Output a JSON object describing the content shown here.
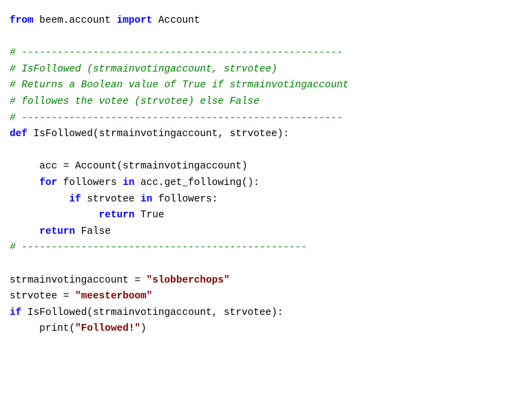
{
  "colors": {
    "background": "#ffffff",
    "keyword": "#0000ff",
    "comment": "#008000",
    "string": "#800000",
    "text": "#000000"
  },
  "code": {
    "language": "Python",
    "lines": [
      [
        [
          "kw",
          "from"
        ],
        [
          "pl",
          " beem.account "
        ],
        [
          "kw",
          "import"
        ],
        [
          "pl",
          " Account"
        ]
      ],
      [],
      [
        [
          "cm",
          "# ------------------------------------------------------"
        ]
      ],
      [
        [
          "cm",
          "# IsFollowed (strmainvotingaccount, strvotee)"
        ]
      ],
      [
        [
          "cm",
          "# Returns a Boolean value of True if strmainvotingaccount"
        ]
      ],
      [
        [
          "cm",
          "# followes the votee (strvotee) else False"
        ]
      ],
      [
        [
          "cm",
          "# ------------------------------------------------------"
        ]
      ],
      [
        [
          "kw",
          "def"
        ],
        [
          "pl",
          " IsFollowed"
        ],
        [
          "op",
          "("
        ],
        [
          "pl",
          "strmainvotingaccount"
        ],
        [
          "op",
          ","
        ],
        [
          "pl",
          " strvotee"
        ],
        [
          "op",
          "):"
        ]
      ],
      [],
      [
        [
          "pl",
          "     acc "
        ],
        [
          "op",
          "="
        ],
        [
          "pl",
          " Account"
        ],
        [
          "op",
          "("
        ],
        [
          "pl",
          "strmainvotingaccount"
        ],
        [
          "op",
          ")"
        ]
      ],
      [
        [
          "pl",
          "     "
        ],
        [
          "kw",
          "for"
        ],
        [
          "pl",
          " followers "
        ],
        [
          "kw",
          "in"
        ],
        [
          "pl",
          " acc.get_following"
        ],
        [
          "op",
          "():"
        ]
      ],
      [
        [
          "pl",
          "          "
        ],
        [
          "kw",
          "if"
        ],
        [
          "pl",
          " strvotee "
        ],
        [
          "kw",
          "in"
        ],
        [
          "pl",
          " followers"
        ],
        [
          "op",
          ":"
        ]
      ],
      [
        [
          "pl",
          "               "
        ],
        [
          "kw",
          "return"
        ],
        [
          "pl",
          " True"
        ]
      ],
      [
        [
          "pl",
          "     "
        ],
        [
          "kw",
          "return"
        ],
        [
          "pl",
          " False"
        ]
      ],
      [
        [
          "cm",
          "# ------------------------------------------------"
        ]
      ],
      [],
      [
        [
          "pl",
          "strmainvotingaccount "
        ],
        [
          "op",
          "="
        ],
        [
          "pl",
          " "
        ],
        [
          "str",
          "\"slobberchops\""
        ]
      ],
      [
        [
          "pl",
          "strvotee "
        ],
        [
          "op",
          "="
        ],
        [
          "pl",
          " "
        ],
        [
          "str",
          "\"meesterboom\""
        ]
      ],
      [
        [
          "kw",
          "if"
        ],
        [
          "pl",
          " IsFollowed"
        ],
        [
          "op",
          "("
        ],
        [
          "pl",
          "strmainvotingaccount"
        ],
        [
          "op",
          ","
        ],
        [
          "pl",
          " strvotee"
        ],
        [
          "op",
          "):"
        ]
      ],
      [
        [
          "pl",
          "     print"
        ],
        [
          "op",
          "("
        ],
        [
          "str",
          "\"Followed!\""
        ],
        [
          "op",
          ")"
        ]
      ]
    ]
  }
}
